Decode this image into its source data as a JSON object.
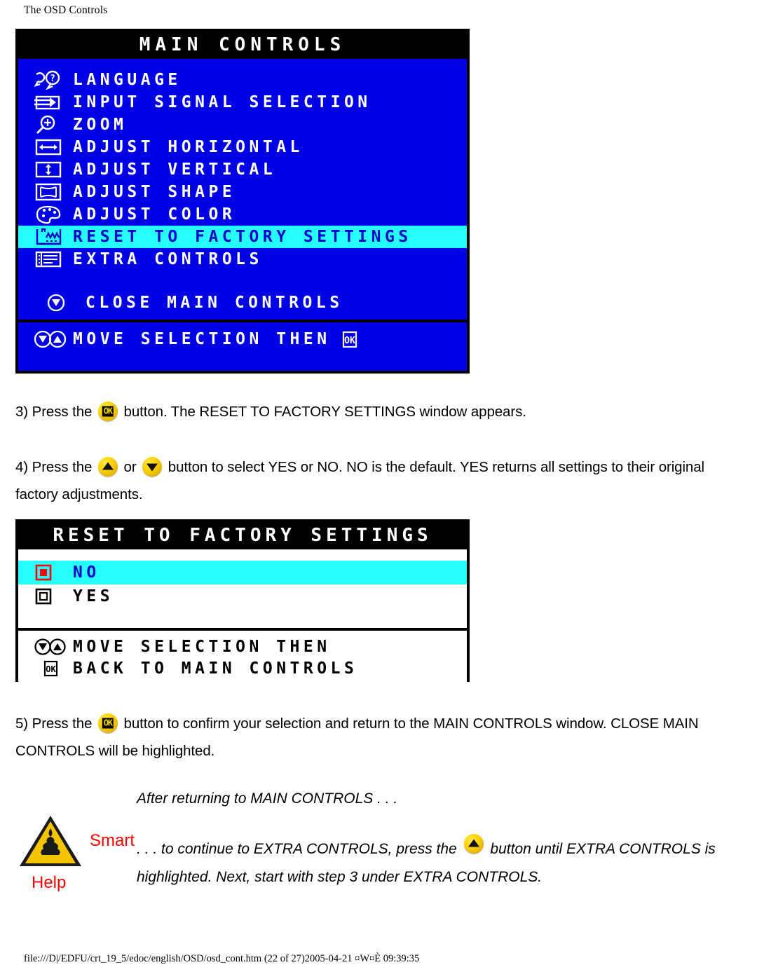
{
  "page": {
    "header": "The OSD Controls",
    "footer": "file:///D|/EDFU/crt_19_5/edoc/english/OSD/osd_cont.htm (22 of 27)2005-04-21 ¤W¤È 09:39:35"
  },
  "main_controls_panel": {
    "title": "MAIN CONTROLS",
    "items": [
      {
        "icon": "language-icon",
        "label": "LANGUAGE",
        "selected": false
      },
      {
        "icon": "input-signal-icon",
        "label": "INPUT SIGNAL SELECTION",
        "selected": false
      },
      {
        "icon": "zoom-icon",
        "label": "ZOOM",
        "selected": false
      },
      {
        "icon": "adjust-horizontal-icon",
        "label": "ADJUST HORIZONTAL",
        "selected": false
      },
      {
        "icon": "adjust-vertical-icon",
        "label": "ADJUST VERTICAL",
        "selected": false
      },
      {
        "icon": "adjust-shape-icon",
        "label": "ADJUST SHAPE",
        "selected": false
      },
      {
        "icon": "adjust-color-icon",
        "label": "ADJUST COLOR",
        "selected": false
      },
      {
        "icon": "factory-reset-icon",
        "label": "RESET TO FACTORY SETTINGS",
        "selected": true
      },
      {
        "icon": "extra-controls-icon",
        "label": "EXTRA CONTROLS",
        "selected": false
      }
    ],
    "close_item": {
      "icon": "down-arrow-icon",
      "label": "CLOSE MAIN CONTROLS"
    },
    "footbar": {
      "icons": "down-up-arrow-icons",
      "label": "MOVE SELECTION THEN",
      "ok_icon": "ok-icon"
    },
    "colors": {
      "background": "#0000e6",
      "title_bar": "#000000",
      "highlight": "#25ffff",
      "highlight_text": "#0000cc"
    }
  },
  "reset_panel": {
    "title": "RESET TO FACTORY SETTINGS",
    "options": [
      {
        "label": "NO",
        "selected": true,
        "radio": "radio-filled-red"
      },
      {
        "label": "YES",
        "selected": false,
        "radio": "radio-empty-black"
      }
    ],
    "foot_lines": [
      {
        "icons": "down-up-arrow-icons",
        "label": "MOVE SELECTION THEN"
      },
      {
        "icons": "ok-icon",
        "label": "BACK TO MAIN CONTROLS"
      }
    ],
    "colors": {
      "background": "#ffffff",
      "title_bar": "#000000",
      "highlight": "#25ffff",
      "highlight_text": "#0000cc",
      "radio_selected": "#ff0000"
    }
  },
  "steps": {
    "step3_pre": "3) Press the",
    "step3_post": "button. The RESET TO FACTORY SETTINGS window appears.",
    "step4_pre": "4) Press the",
    "step4_mid": "or",
    "step4_post": "button to select YES or NO. NO is the default. YES returns all settings to",
    "step4_line2": "their original factory adjustments.",
    "step5_pre": "5) Press the",
    "step5_post": "button to confirm your selection and return to the MAIN CONTROLS window.",
    "step5_line2": "CLOSE MAIN CONTROLS will be highlighted."
  },
  "smart_help": {
    "icon": "smart-help-warning-icon",
    "smart_label": "Smart",
    "help_label": "Help",
    "line1": "After returning to MAIN CONTROLS . . .",
    "line2_pre": ". . . to continue to EXTRA CONTROLS, press the",
    "line2_post": "button until EXTRA",
    "line3": "CONTROLS is highlighted. Next, start with step 3 under EXTRA CONTROLS.",
    "accent_color": "#ff0000"
  }
}
